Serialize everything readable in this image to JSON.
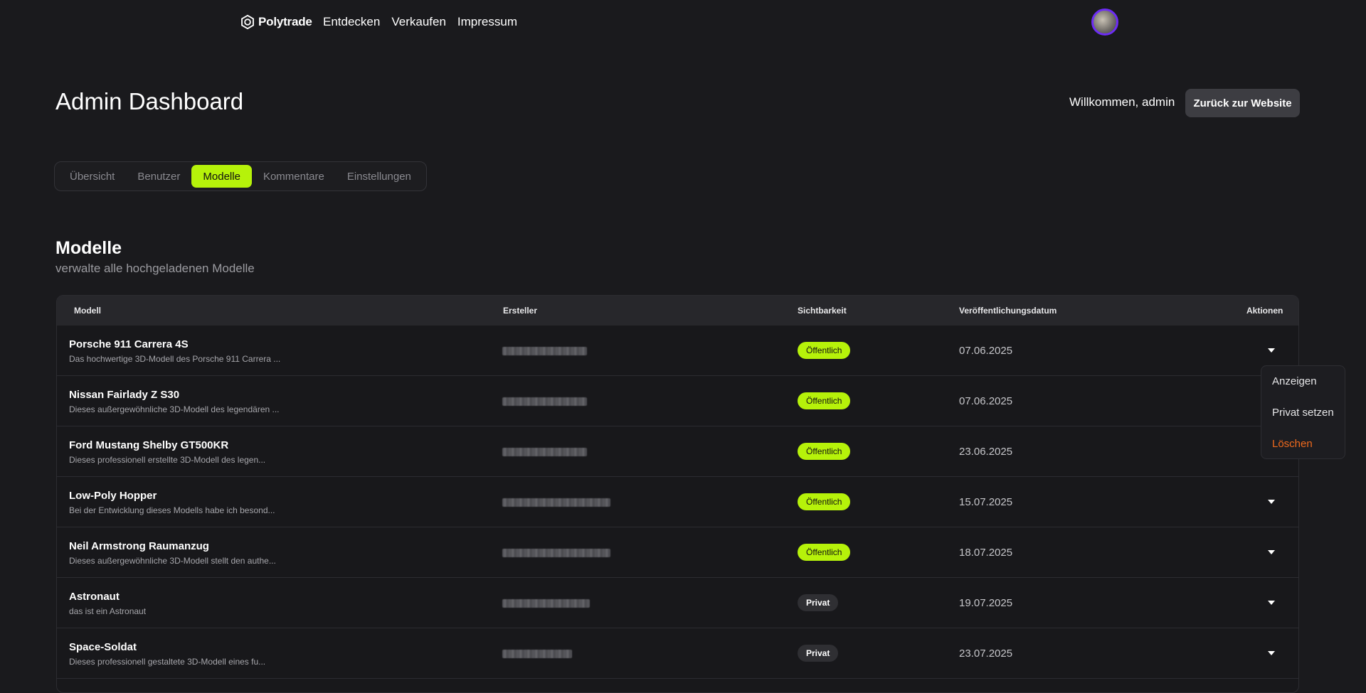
{
  "nav": {
    "brand": "Polytrade",
    "links": [
      "Entdecken",
      "Verkaufen",
      "Impressum"
    ]
  },
  "header": {
    "title": "Admin Dashboard",
    "welcome": "Willkommen, admin",
    "back_label": "Zurück zur Website"
  },
  "tabs": [
    {
      "label": "Übersicht",
      "active": false
    },
    {
      "label": "Benutzer",
      "active": false
    },
    {
      "label": "Modelle",
      "active": true
    },
    {
      "label": "Kommentare",
      "active": false
    },
    {
      "label": "Einstellungen",
      "active": false
    }
  ],
  "section": {
    "title": "Modelle",
    "subtitle": "verwalte alle hochgeladenen Modelle"
  },
  "table": {
    "columns": [
      "Modell",
      "Ersteller",
      "Sichtbarkeit",
      "Veröffentlichungsdatum",
      "Aktionen"
    ],
    "rows": [
      {
        "name": "Porsche 911 Carrera 4S",
        "desc": "Das hochwertige 3D-Modell des Porsche 911 Carrera ...",
        "visibility": "Öffentlich",
        "public": true,
        "date": "07.06.2025"
      },
      {
        "name": "Nissan Fairlady Z S30",
        "desc": "Dieses außergewöhnliche 3D-Modell des legendären ...",
        "visibility": "Öffentlich",
        "public": true,
        "date": "07.06.2025"
      },
      {
        "name": "Ford Mustang Shelby GT500KR",
        "desc": "Dieses professionell erstellte 3D-Modell des legen...",
        "visibility": "Öffentlich",
        "public": true,
        "date": "23.06.2025"
      },
      {
        "name": "Low-Poly Hopper",
        "desc": "Bei der Entwicklung dieses Modells habe ich besond...",
        "visibility": "Öffentlich",
        "public": true,
        "date": "15.07.2025"
      },
      {
        "name": "Neil Armstrong Raumanzug",
        "desc": "Dieses außergewöhnliche 3D-Modell stellt den authe...",
        "visibility": "Öffentlich",
        "public": true,
        "date": "18.07.2025"
      },
      {
        "name": "Astronaut",
        "desc": "das ist ein Astronaut",
        "visibility": "Privat",
        "public": false,
        "date": "19.07.2025"
      },
      {
        "name": "Space-Soldat",
        "desc": "Dieses professionell gestaltete 3D-Modell eines fu...",
        "visibility": "Privat",
        "public": false,
        "date": "23.07.2025"
      }
    ]
  },
  "dropdown": {
    "items": [
      "Anzeigen",
      "Privat setzen",
      "Löschen"
    ]
  },
  "colors": {
    "background": "#1a1a1d",
    "accent": "#b6f20a",
    "danger": "#f06a1d",
    "avatar_ring": "#6d2cf5"
  }
}
